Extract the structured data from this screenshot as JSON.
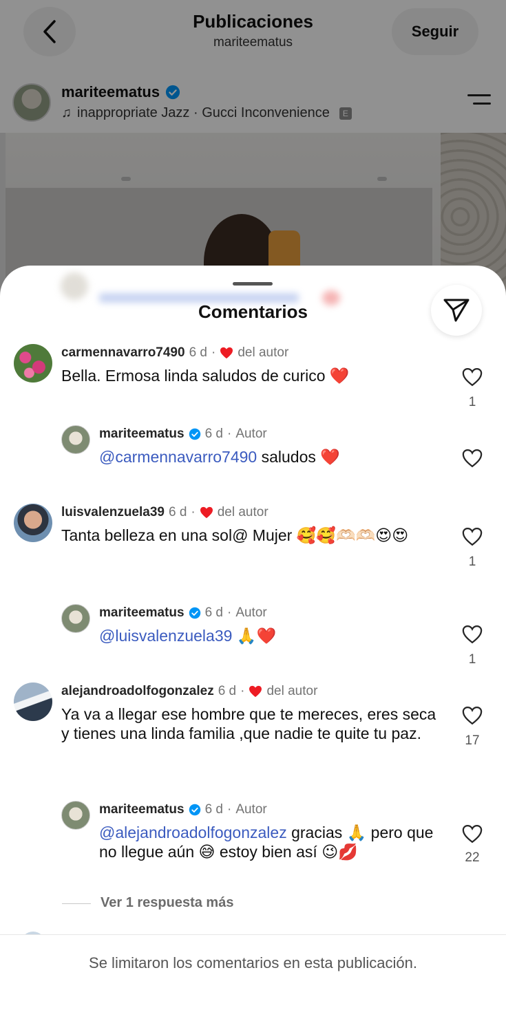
{
  "header": {
    "title": "Publicaciones",
    "subtitle": "mariteematus",
    "follow_label": "Seguir"
  },
  "post": {
    "username": "mariteematus",
    "music": "inappropriate Jazz · Gucci Inconvenience",
    "explicit_badge": "E"
  },
  "comments_sheet": {
    "title": "Comentarios",
    "comments": [
      {
        "username": "carmennavarro7490",
        "time": "6 d",
        "author_tag": "del autor",
        "text": "Bella. Ermosa linda  saludos  de  curico ❤️",
        "likes": "1"
      },
      {
        "username": "mariteematus",
        "time": "6 d",
        "author_tag": "Autor",
        "mention": "@carmennavarro7490",
        "text": " saludos ❤️",
        "likes": ""
      },
      {
        "username": "luisvalenzuela39",
        "time": "6 d",
        "author_tag": "del autor",
        "text": "Tanta belleza en una sol@ Mujer 🥰🥰🫶🏻🫶🏻😍😍",
        "likes": "1"
      },
      {
        "username": "mariteematus",
        "time": "6 d",
        "author_tag": "Autor",
        "mention": "@luisvalenzuela39",
        "text": " 🙏❤️",
        "likes": "1"
      },
      {
        "username": "alejandroadolfogonzalez",
        "time": "6 d",
        "author_tag": "del autor",
        "text": "Ya va a llegar ese hombre que te mereces, eres seca y tienes una linda familia ,que nadie te quite tu paz.",
        "likes": "17"
      },
      {
        "username": "mariteematus",
        "time": "6 d",
        "author_tag": "Autor",
        "mention": "@alejandroadolfogonzalez",
        "text": " gracias 🙏 pero que no llegue aún 😅 estoy bien así 😉💋",
        "likes": "22"
      }
    ],
    "more_replies": "Ver 1 respuesta más",
    "footer_notice": "Se limitaron los comentarios en esta publicación."
  },
  "colors": {
    "mention": "#3b5bbf",
    "heart_red": "#ed1c24",
    "verified_blue": "#0095f6"
  }
}
